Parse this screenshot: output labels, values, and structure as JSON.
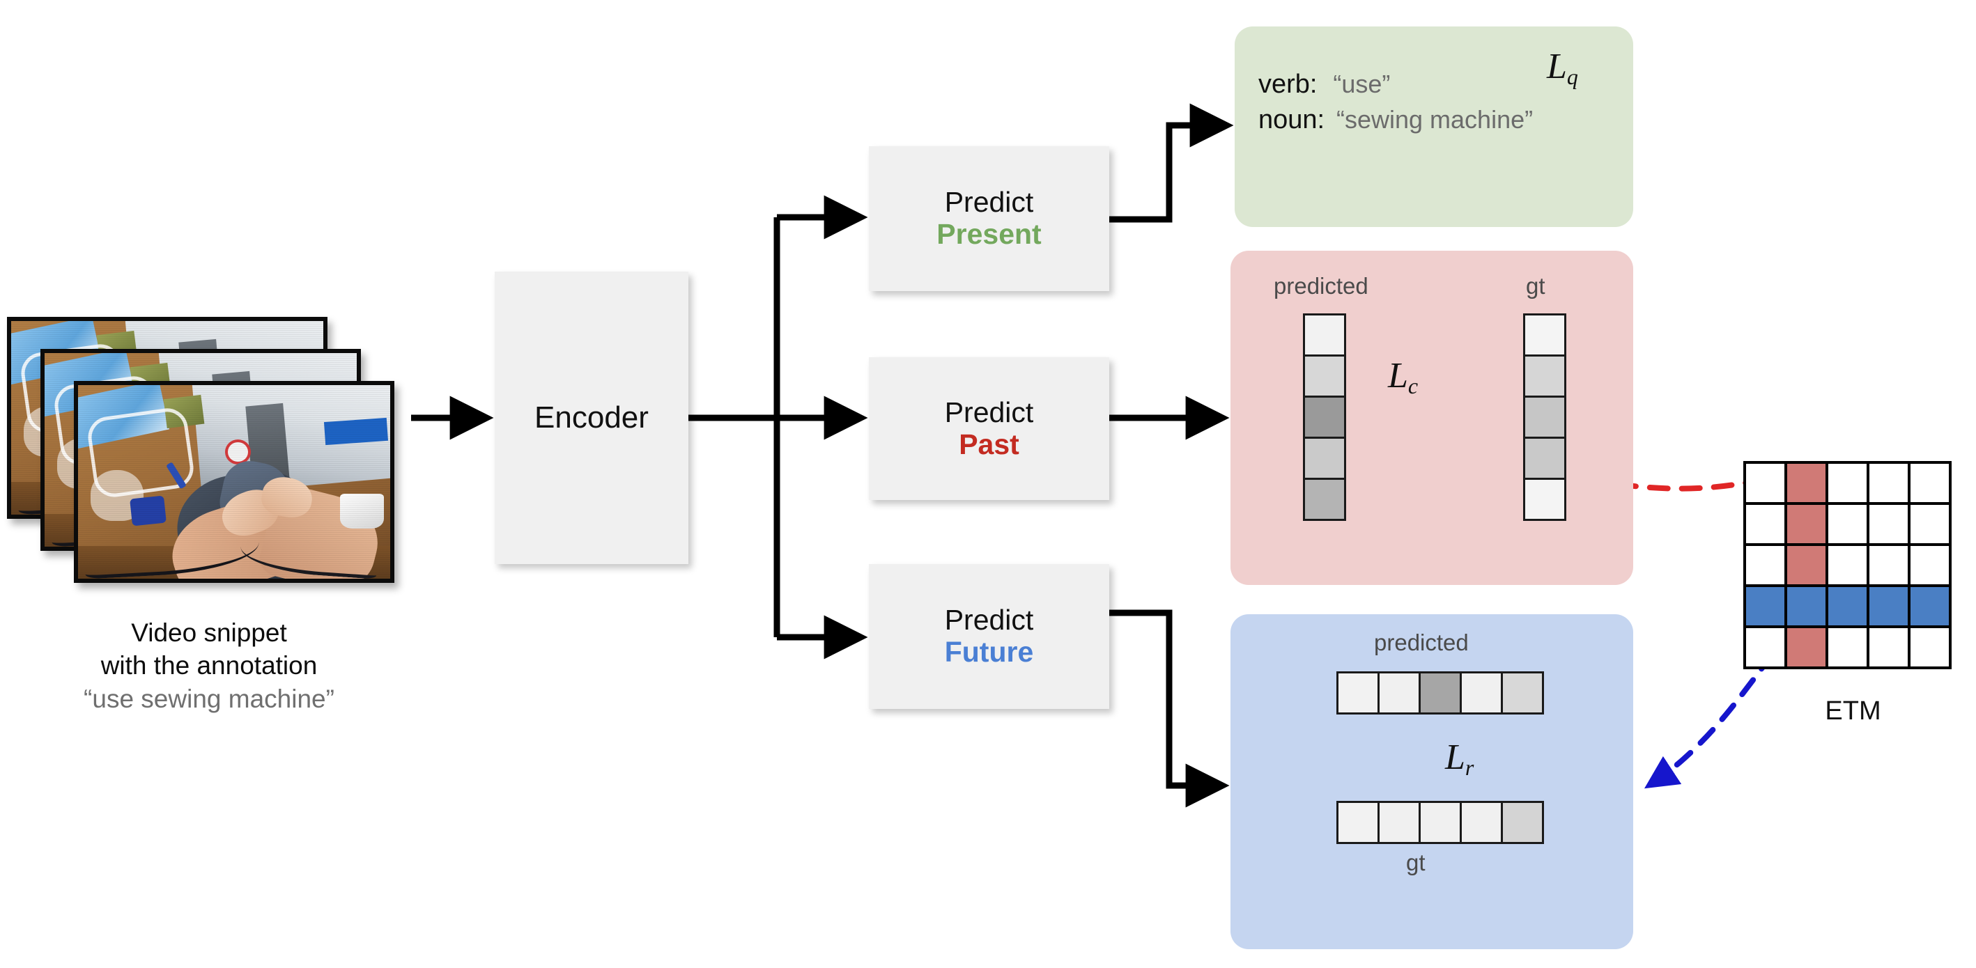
{
  "video": {
    "caption_line1": "Video snippet",
    "caption_line2": "with the annotation",
    "caption_quote": "“use sewing machine”",
    "frame_count": 3
  },
  "encoder": {
    "label": "Encoder"
  },
  "predict_heads": [
    {
      "name": "present",
      "line1": "Predict",
      "line2": "Present",
      "color": "#73a85d"
    },
    {
      "name": "past",
      "line1": "Predict",
      "line2": "Past",
      "color": "#c32b21"
    },
    {
      "name": "future",
      "line1": "Predict",
      "line2": "Future",
      "color": "#4a7fd4"
    }
  ],
  "present_panel": {
    "bg": "#dce7d2",
    "verb_key": "verb:",
    "verb_value": "“use”",
    "noun_key": "noun:",
    "noun_value": "“sewing machine”",
    "loss_symbol": "L",
    "loss_subscript": "q"
  },
  "past_panel": {
    "bg": "#f0cfce",
    "predicted_label": "predicted",
    "gt_label": "gt",
    "loss_symbol": "L",
    "loss_subscript": "c",
    "predicted_cells": [
      "#f2f2f2",
      "#d7d7d7",
      "#9a9a9a",
      "#cacaca",
      "#b4b4b4"
    ],
    "gt_cells": [
      "#f4f4f4",
      "#d6d6d6",
      "#c6c6c6",
      "#c9c9c9",
      "#f4f4f4"
    ]
  },
  "future_panel": {
    "bg": "#c5d5f0",
    "predicted_label": "predicted",
    "gt_label": "gt",
    "loss_symbol": "L",
    "loss_subscript": "r",
    "predicted_cells": [
      "#f2f2f2",
      "#f0f0f0",
      "#a6a6a6",
      "#f0f0f0",
      "#d8d8d8"
    ],
    "gt_cells": [
      "#f2f2f2",
      "#f0f0f0",
      "#f0f0f0",
      "#f0f0f0",
      "#d4d4d4"
    ]
  },
  "etm": {
    "label": "ETM",
    "rows": 5,
    "cols": 5,
    "highlight_column_index": 1,
    "highlight_row_index": 3,
    "column_color": "#d07a76",
    "row_color": "#4a7fc4",
    "cells": [
      [
        "#ffffff",
        "#d07a76",
        "#ffffff",
        "#ffffff",
        "#ffffff"
      ],
      [
        "#ffffff",
        "#d07a76",
        "#ffffff",
        "#ffffff",
        "#ffffff"
      ],
      [
        "#ffffff",
        "#d07a76",
        "#ffffff",
        "#ffffff",
        "#ffffff"
      ],
      [
        "#4a7fc4",
        "#4a7fc4",
        "#4a7fc4",
        "#4a7fc4",
        "#4a7fc4"
      ],
      [
        "#ffffff",
        "#d07a76",
        "#ffffff",
        "#ffffff",
        "#ffffff"
      ]
    ]
  },
  "connectors": {
    "arrow_color": "#000000",
    "etm_to_past_color": "#e02626",
    "etm_to_future_color": "#1616cc"
  }
}
